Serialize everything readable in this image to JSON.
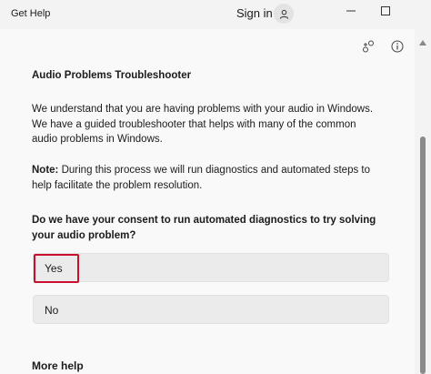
{
  "titlebar": {
    "app_title": "Get Help",
    "signin_label": "Sign in"
  },
  "icons": {
    "avatar": "person-icon",
    "minimize": "minimize-icon",
    "maximize": "maximize-icon",
    "share": "connect-icon",
    "info": "info-icon",
    "scroll_up": "chevron-up-icon"
  },
  "content": {
    "heading": "Audio Problems Troubleshooter",
    "intro": "We understand that you are having problems with your audio in Windows. We have a guided troubleshooter that helps with many of the common audio problems in Windows.",
    "note_label": "Note:",
    "note_text": " During this process we will run diagnostics and automated steps to help facilitate the problem resolution.",
    "question": "Do we have your consent to run automated diagnostics to try solving your audio problem?",
    "options": [
      {
        "label": "Yes"
      },
      {
        "label": "No"
      }
    ],
    "more_help": "More help"
  },
  "colors": {
    "highlight": "#c8102e",
    "background": "#f9f9f9",
    "option_bg": "#ebebeb"
  }
}
